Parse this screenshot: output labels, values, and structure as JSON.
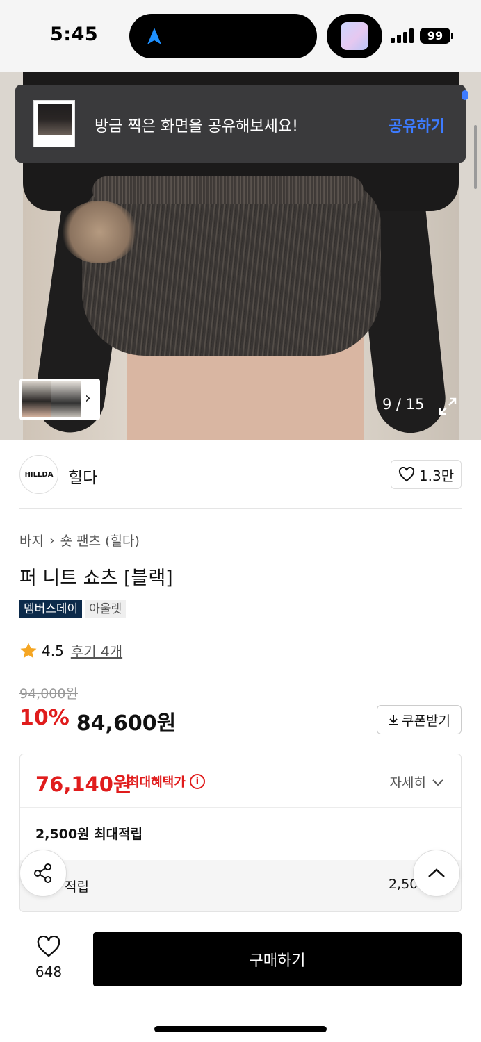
{
  "status_bar": {
    "time": "5:45",
    "battery": "99"
  },
  "toast": {
    "message": "방금 찍은 화면을 공유해보세요!",
    "action": "공유하기"
  },
  "gallery": {
    "counter": "9 / 15"
  },
  "brand": {
    "logo_text": "HILLDA",
    "name": "힐다",
    "likes": "1.3만"
  },
  "breadcrumb": {
    "category": "바지",
    "subcategory": "숏 팬츠 (힐다)"
  },
  "product": {
    "title": "퍼 니트 쇼츠 [블랙]",
    "badges": [
      "멤버스데이",
      "아울렛"
    ],
    "rating": "4.5",
    "reviews": "후기 4개",
    "original_price": "94,000원",
    "discount": "10%",
    "price": "84,600원",
    "coupon_label": "쿠폰받기"
  },
  "benefit": {
    "max_price": "76,140원",
    "max_label": "최대혜택가",
    "detail_label": "자세히",
    "points_max": "2,500원 최대적립",
    "points_row_label": "적립",
    "points_row_value": "2,50"
  },
  "bottom_bar": {
    "wish_count": "648",
    "buy_label": "구매하기"
  },
  "colors": {
    "accent_red": "#e01c1c",
    "toast_action": "#3d7bff",
    "badge_dark": "#0c2a4a"
  }
}
